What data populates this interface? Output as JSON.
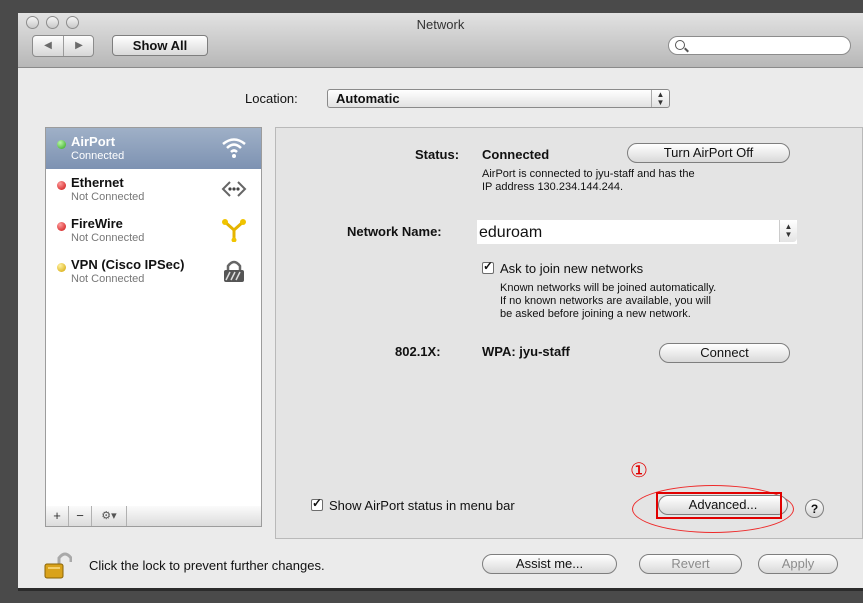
{
  "window": {
    "title": "Network"
  },
  "toolbar": {
    "show_all": "Show All",
    "search": {
      "placeholder": "",
      "value": ""
    }
  },
  "location": {
    "label": "Location:",
    "value": "Automatic"
  },
  "services": [
    {
      "name": "AirPort",
      "status": "Connected",
      "icon": "wifi-icon",
      "dot": "green",
      "selected": true
    },
    {
      "name": "Ethernet",
      "status": "Not Connected",
      "icon": "ethernet-icon",
      "dot": "red"
    },
    {
      "name": "FireWire",
      "status": "Not Connected",
      "icon": "firewire-icon",
      "dot": "red"
    },
    {
      "name": "VPN (Cisco IPSec)",
      "status": "Not Connected",
      "icon": "vpn-lock-icon",
      "dot": "yellow"
    }
  ],
  "sidebar_toolbar": {
    "add": "+",
    "remove": "−",
    "gear": "⚙▾"
  },
  "detail": {
    "status_label": "Status:",
    "status_value": "Connected",
    "turn_off_button": "Turn AirPort Off",
    "status_desc_line1": "AirPort is connected to jyu-staff and has the",
    "status_desc_line2": "IP address 130.234.144.244.",
    "network_name_label": "Network Name:",
    "network_name_value": "eduroam",
    "ask_join_label": "Ask to join new networks",
    "ask_join_checked": true,
    "ask_join_desc_line1": "Known networks will be joined automatically.",
    "ask_join_desc_line2": "If no known networks are available, you will",
    "ask_join_desc_line3": "be asked before joining a new network.",
    "dot1x_label": "802.1X:",
    "dot1x_value": "WPA: jyu-staff",
    "connect_button": "Connect",
    "show_status_label": "Show AirPort status in menu bar",
    "show_status_checked": true,
    "advanced_button": "Advanced...",
    "help_button": "?"
  },
  "annotation": {
    "step": "①"
  },
  "footer": {
    "lock_text": "Click the lock to prevent further changes.",
    "assist_button": "Assist me...",
    "revert_button": "Revert",
    "apply_button": "Apply"
  },
  "colors": {
    "highlight": "#e10000",
    "selection": "#7d92b2",
    "dot_green": "#2fa51b",
    "dot_red": "#cc1010",
    "dot_yellow": "#d3a400"
  }
}
